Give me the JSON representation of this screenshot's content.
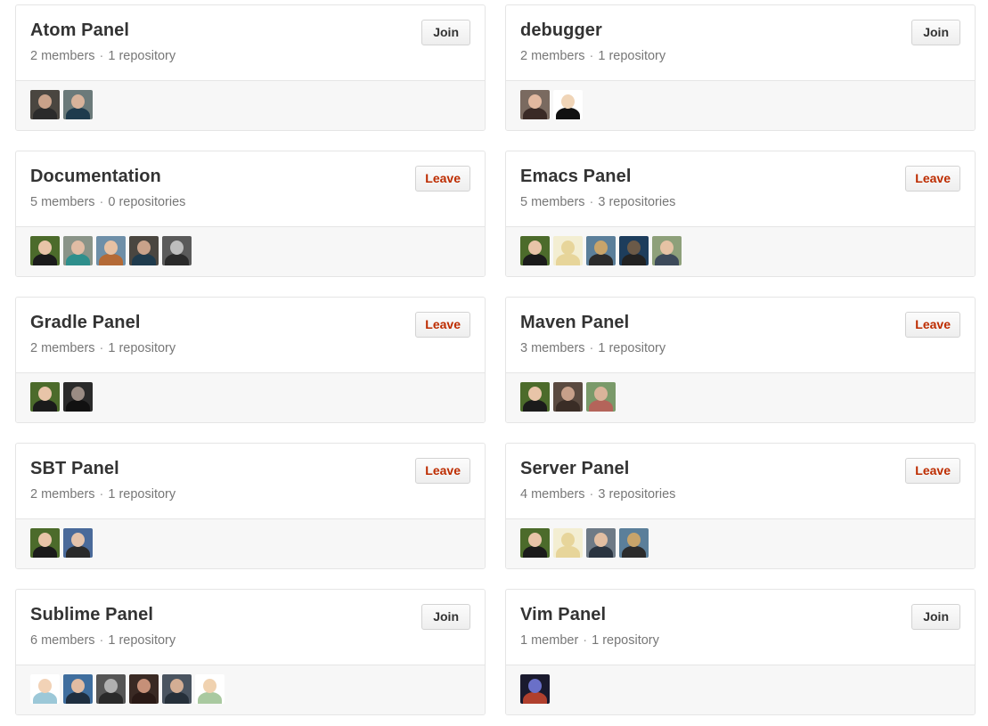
{
  "teams": [
    {
      "name": "Atom Panel",
      "members": "2 members",
      "repos": "1 repository",
      "action": "Join",
      "action_type": "join",
      "avatars": [
        {
          "bg": "#4a4640",
          "skin": "#c9a28a",
          "shirt": "#2b2b2b"
        },
        {
          "bg": "#6b7a7a",
          "skin": "#d8b39b",
          "shirt": "#1f3b4d"
        }
      ]
    },
    {
      "name": "debugger",
      "members": "2 members",
      "repos": "1 repository",
      "action": "Join",
      "action_type": "join",
      "avatars": [
        {
          "bg": "#7a6a60",
          "skin": "#e3b9a0",
          "shirt": "#3a2a26"
        },
        {
          "bg": "#ffffff",
          "skin": "#f0d5b8",
          "shirt": "#111111"
        }
      ]
    },
    {
      "name": "Documentation",
      "members": "5 members",
      "repos": "0 repositories",
      "action": "Leave",
      "action_type": "leave",
      "avatars": [
        {
          "bg": "#4c6b2b",
          "skin": "#e8c4a8",
          "shirt": "#1b1b1b"
        },
        {
          "bg": "#8a9488",
          "skin": "#e1bca4",
          "shirt": "#2e8f8c"
        },
        {
          "bg": "#6e8fa8",
          "skin": "#e7c1a3",
          "shirt": "#b46a36"
        },
        {
          "bg": "#4a4640",
          "skin": "#c9a28a",
          "shirt": "#1f3b4d"
        },
        {
          "bg": "#5a5a5a",
          "skin": "#bdbdbd",
          "shirt": "#2a2a2a"
        }
      ]
    },
    {
      "name": "Emacs Panel",
      "members": "5 members",
      "repos": "3 repositories",
      "action": "Leave",
      "action_type": "leave",
      "avatars": [
        {
          "bg": "#4c6b2b",
          "skin": "#e8c4a8",
          "shirt": "#1b1b1b"
        },
        {
          "bg": "#f3eed2",
          "skin": "#e7d59a",
          "shirt": "#e7d59a"
        },
        {
          "bg": "#5b7f9a",
          "skin": "#c8a46a",
          "shirt": "#2b2b2b"
        },
        {
          "bg": "#1d3d5c",
          "skin": "#6b5a48",
          "shirt": "#222222"
        },
        {
          "bg": "#8ea07a",
          "skin": "#e6c2a4",
          "shirt": "#3d4a5a"
        }
      ]
    },
    {
      "name": "Gradle Panel",
      "members": "2 members",
      "repos": "1 repository",
      "action": "Leave",
      "action_type": "leave",
      "avatars": [
        {
          "bg": "#4c6b2b",
          "skin": "#e8c4a8",
          "shirt": "#1b1b1b"
        },
        {
          "bg": "#2a2a2a",
          "skin": "#9a8c84",
          "shirt": "#111111"
        }
      ]
    },
    {
      "name": "Maven Panel",
      "members": "3 members",
      "repos": "1 repository",
      "action": "Leave",
      "action_type": "leave",
      "avatars": [
        {
          "bg": "#4c6b2b",
          "skin": "#e8c4a8",
          "shirt": "#1b1b1b"
        },
        {
          "bg": "#5a4a40",
          "skin": "#c7a08a",
          "shirt": "#3a2d26"
        },
        {
          "bg": "#7a9a6a",
          "skin": "#d9b49a",
          "shirt": "#b4645a"
        }
      ]
    },
    {
      "name": "SBT Panel",
      "members": "2 members",
      "repos": "1 repository",
      "action": "Leave",
      "action_type": "leave",
      "avatars": [
        {
          "bg": "#4c6b2b",
          "skin": "#e8c4a8",
          "shirt": "#1b1b1b"
        },
        {
          "bg": "#4a6a9a",
          "skin": "#e5c3ab",
          "shirt": "#2a2a2a"
        }
      ]
    },
    {
      "name": "Server Panel",
      "members": "4 members",
      "repos": "3 repositories",
      "action": "Leave",
      "action_type": "leave",
      "avatars": [
        {
          "bg": "#4c6b2b",
          "skin": "#e8c4a8",
          "shirt": "#1b1b1b"
        },
        {
          "bg": "#f3eed2",
          "skin": "#e7d59a",
          "shirt": "#e7d59a"
        },
        {
          "bg": "#6e7a86",
          "skin": "#e2bea2",
          "shirt": "#2a3440"
        },
        {
          "bg": "#5b7f9a",
          "skin": "#c8a46a",
          "shirt": "#2b2b2b"
        }
      ]
    },
    {
      "name": "Sublime Panel",
      "members": "6 members",
      "repos": "1 repository",
      "action": "Join",
      "action_type": "join",
      "avatars": [
        {
          "bg": "#ffffff",
          "skin": "#f2d2b6",
          "shirt": "#9cc8d8"
        },
        {
          "bg": "#3f6e9e",
          "skin": "#e2bca2",
          "shirt": "#1f2f40"
        },
        {
          "bg": "#555555",
          "skin": "#b0b0b0",
          "shirt": "#2a2a2a"
        },
        {
          "bg": "#3a2a24",
          "skin": "#c69078",
          "shirt": "#2a1a16"
        },
        {
          "bg": "#4a5460",
          "skin": "#d4ae94",
          "shirt": "#26303a"
        },
        {
          "bg": "#ffffff",
          "skin": "#f0d2b0",
          "shirt": "#a9c9a0"
        }
      ]
    },
    {
      "name": "Vim Panel",
      "members": "1 member",
      "repos": "1 repository",
      "action": "Join",
      "action_type": "join",
      "avatars": [
        {
          "bg": "#1a1a2e",
          "skin": "#6a70c8",
          "shirt": "#b0402e"
        }
      ]
    }
  ],
  "separator": "·",
  "colors": {
    "card_border": "#e5e5e5",
    "footer_bg": "#f7f7f7",
    "title": "#333333",
    "meta": "#777777",
    "leave_text": "#bd2c00",
    "join_text": "#333333"
  }
}
